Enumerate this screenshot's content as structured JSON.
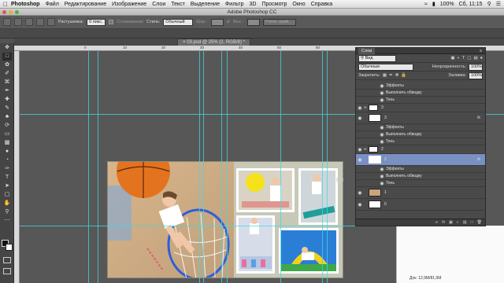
{
  "menubar": {
    "app_name": "Photoshop",
    "items": [
      "Файл",
      "Редактирование",
      "Изображение",
      "Слои",
      "Текст",
      "Выделение",
      "Фильтр",
      "3D",
      "Просмотр",
      "Окно",
      "Справка"
    ],
    "battery": "100%",
    "clock": "Сб, 11:15"
  },
  "appbar": {
    "title": "Adobe Photoshop CC"
  },
  "options": {
    "feather_label": "Растушевка:",
    "feather_value": "0 пикс.",
    "antialias_label": "Сглаживание",
    "style_label": "Стиль:",
    "style_value": "Обычный",
    "width_label": "Шир.:",
    "height_label": "Выс.:",
    "refine_button": "Уточн. край..."
  },
  "document": {
    "tab_title": "03.psd @ 25% (2, RGB/8) *"
  },
  "ruler_numbers": [
    "0",
    "10",
    "20",
    "30",
    "40",
    "50",
    "60"
  ],
  "layers_panel": {
    "title": "Слои",
    "filter_value": "Вид",
    "blend_mode": "Обычные",
    "opacity_label": "Непрозрачность:",
    "opacity_value": "100%",
    "lock_label": "Закрепить:",
    "fill_label": "Заливка:",
    "fill_value": "100%",
    "rows": [
      {
        "label": "Эффекты",
        "kind": "effects"
      },
      {
        "label": "Выполнить обводку",
        "kind": "effect"
      },
      {
        "label": "Тень",
        "kind": "effect"
      },
      {
        "label": "3",
        "kind": "group"
      },
      {
        "label": "3",
        "kind": "layer",
        "fx": "fx"
      },
      {
        "label": "Эффекты",
        "kind": "effects"
      },
      {
        "label": "Выполнить обводку",
        "kind": "effect"
      },
      {
        "label": "Тень",
        "kind": "effect"
      },
      {
        "label": "2",
        "kind": "group"
      },
      {
        "label": "2",
        "kind": "layer",
        "fx": "fx",
        "selected": true
      },
      {
        "label": "Эффекты",
        "kind": "effects"
      },
      {
        "label": "Выполнить обводку",
        "kind": "effect"
      },
      {
        "label": "Тень",
        "kind": "effect"
      },
      {
        "label": "1",
        "kind": "layer"
      },
      {
        "label": "0",
        "kind": "layer"
      }
    ]
  },
  "status": {
    "doc_size": "Док: 12,9M/81,9M"
  },
  "colors": {
    "guide": "#3fd9e6",
    "selected_layer": "#7a8fc2",
    "panel_bg": "#4a4a4a"
  }
}
